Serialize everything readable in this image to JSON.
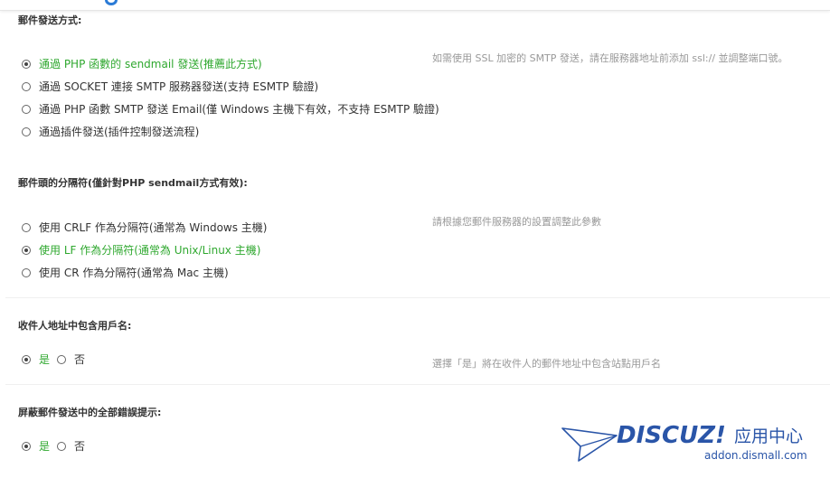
{
  "colors": {
    "selected": "#2fa82f",
    "hint": "#999999",
    "brand": "#2a55a8"
  },
  "mail_method": {
    "title": "郵件發送方式:",
    "hint": "如需使用 SSL 加密的 SMTP 發送，請在服務器地址前添加 ssl:// 並調整端口號。",
    "options": [
      {
        "label": "通過 PHP 函數的 sendmail 發送(推薦此方式)",
        "checked": true
      },
      {
        "label": "通過 SOCKET 連接 SMTP 服務器發送(支持 ESMTP 驗證)",
        "checked": false
      },
      {
        "label": "通過 PHP 函數 SMTP 發送 Email(僅 Windows 主機下有效，不支持 ESMTP 驗證)",
        "checked": false
      },
      {
        "label": "通過插件發送(插件控制發送流程)",
        "checked": false
      }
    ]
  },
  "separator": {
    "title": "郵件頭的分隔符(僅針對PHP sendmail方式有效):",
    "hint": "請根據您郵件服務器的設置調整此參數",
    "options": [
      {
        "label": "使用 CRLF 作為分隔符(通常為 Windows 主機)",
        "checked": false
      },
      {
        "label": "使用 LF 作為分隔符(通常為 Unix/Linux 主機)",
        "checked": true
      },
      {
        "label": "使用 CR 作為分隔符(通常為 Mac 主機)",
        "checked": false
      }
    ]
  },
  "include_username": {
    "title": "收件人地址中包含用戶名:",
    "hint": "選擇「是」將在收件人的郵件地址中包含站點用戶名",
    "yes": "是",
    "no": "否"
  },
  "silent_errors": {
    "title": "屏蔽郵件發送中的全部錯誤提示:",
    "yes": "是",
    "no": "否"
  },
  "watermark": {
    "brand": "DISCUZ!",
    "brand_sub": "应用中心",
    "url": "addon.dismall.com"
  }
}
